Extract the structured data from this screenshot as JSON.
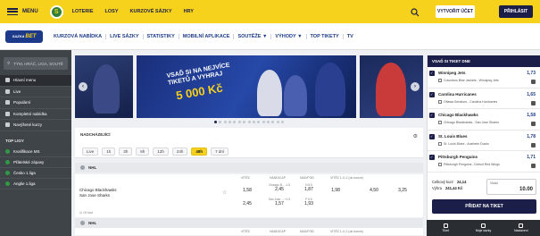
{
  "topbar": {
    "menu_label": "MENU",
    "nav": [
      "LOTERIE",
      "LOSY",
      "KURZOVÉ SÁZKY",
      "HRY"
    ],
    "register": "VYTVOŘIT ÚČET",
    "login": "PŘIHLÁSIT",
    "accent": "#f6d21c"
  },
  "navbar": {
    "brand_a": "SAZKA",
    "brand_b": "BET",
    "items": [
      "KURZOVÁ NABÍDKA",
      "LIVE SÁZKY",
      "STATISTIKY",
      "MOBILNÍ APLIKACE",
      "SOUTĚŽE",
      "VÝHODY",
      "TOP TIKETY",
      "TV"
    ]
  },
  "sidebar": {
    "search_placeholder": "TÝM, HRÁČ, LIGA, SOUTĚ",
    "items": [
      "Hlavní menu",
      "Live",
      "Populární",
      "Kompletní nabídka",
      "Navýšené kurzy"
    ],
    "leagues_title": "TOP LIGY",
    "leagues": [
      "Kvalifikace MS",
      "Přátelské zápasy",
      "Česko 1.liga",
      "Anglie 1.liga"
    ]
  },
  "banner": {
    "promo_line1": "VSAĎ SI NA NEJVÍCE",
    "promo_line2": "TIKETŮ A VYHRAJ",
    "promo_amount": "5 000 Kč"
  },
  "upcoming": {
    "title": "NADCHÁZEJÍCÍ",
    "filters": [
      "Live",
      "1h",
      "3h",
      "6h",
      "12h",
      "24h",
      "48h",
      "7 dní"
    ],
    "active_filter": "48h"
  },
  "league1": {
    "name": "NHL",
    "columns": [
      "VÍTĚZ",
      "HANDICAP",
      "NAD/POD",
      "VÍTĚZ 1-X-2 (do konce)"
    ]
  },
  "match": {
    "home": "Chicago Blackhawks",
    "away": "San Jose Sharks",
    "time": "19 hod",
    "winner_1": "1,58",
    "winner_2": "2,45",
    "hc_label_1": "Chicago B... -1,5",
    "hc_label_2": "San Jose ... +1,5",
    "hc_1": "2,45",
    "hc_2": "1,57",
    "ou_label_1": "N 6.5",
    "ou_label_2": "P 6.5",
    "ou_1": "1,87",
    "ou_2": "1,93",
    "x1": "1,98",
    "x0": "4,50",
    "x2": "3,25"
  },
  "league2": {
    "name": "NHL",
    "columns": [
      "VÍTĚZ",
      "HANDICAP",
      "NAD/POD",
      "VÍTĚZ 1-X-2 (do konce)"
    ]
  },
  "betslip": {
    "title": "VSAĎ SI TIKET DNE",
    "items": [
      {
        "team": "Winnipeg Jets",
        "odd": "1,73",
        "match": "Columbus Blue Jackets - Winnipeg Jets"
      },
      {
        "team": "Carolina Hurricanes",
        "odd": "1,65",
        "match": "Ottawa Senators - Carolina Hurricanes"
      },
      {
        "team": "Chicago Blackhawks",
        "odd": "1,58",
        "match": "Chicago Blackhawks - San Jose Sharks"
      },
      {
        "team": "St. Louis Blues",
        "odd": "1,78",
        "match": "St. Louis Blues - Anaheim Ducks"
      },
      {
        "team": "Pittsburgh Penguins",
        "odd": "1,71",
        "match": "Pittsburgh Penguins - Detroit Red Wings"
      }
    ],
    "total_label": "Celkový kurz",
    "total_value": "24,14",
    "win_label": "Výhra",
    "win_value": "241,44 Kč",
    "stake_label": "Vklad",
    "stake_value": "10.00",
    "submit": "PŘIDAT NA TIKET"
  },
  "bottom_bar": [
    "Tiket",
    "Moje sázky",
    "Nastavení"
  ]
}
